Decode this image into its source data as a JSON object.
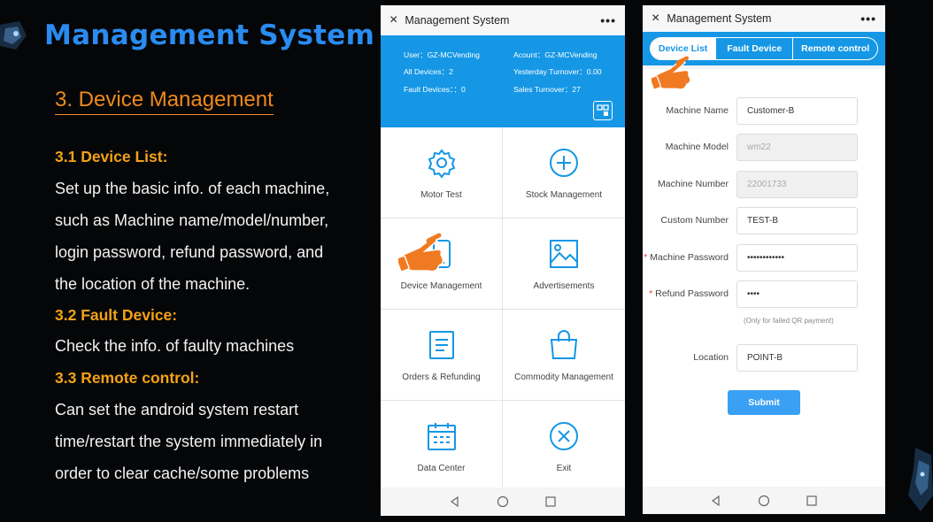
{
  "slide": {
    "title": "Management System",
    "section": "3. Device Management",
    "sub1": "3.1 Device List:",
    "p1": [
      "Set up the basic info. of each machine,",
      "such as Machine name/model/number,",
      "login password, refund password, and",
      "the location of the machine."
    ],
    "sub2": "3.2 Fault Device:",
    "p2": [
      "Check the info. of faulty machines"
    ],
    "sub3": "3.3 Remote control:",
    "p3": [
      "Can set the android system restart",
      "time/restart the system immediately in",
      "order to clear cache/some problems"
    ]
  },
  "phone1": {
    "topbar": {
      "title": "Management System",
      "close_icon": "×",
      "more_icon": "•••"
    },
    "info": {
      "user": "User：GZ-MCVending",
      "account": "Acount：GZ-MCVending",
      "all_devices": "All Devices：2",
      "yesterday_turnover": "Yesterday Turnover：0.00",
      "fault_devices": "Fault Devices：：0",
      "sales_turnover": "Sales Turnover：27"
    },
    "tiles": [
      {
        "label": "Motor Test",
        "icon": "gear-icon"
      },
      {
        "label": "Stock Management",
        "icon": "plus-circle-icon"
      },
      {
        "label": "Device Management",
        "icon": "phone-icon"
      },
      {
        "label": "Advertisements",
        "icon": "image-icon"
      },
      {
        "label": "Orders & Refunding",
        "icon": "document-icon"
      },
      {
        "label": "Commodity Management",
        "icon": "shopping-bag-icon"
      },
      {
        "label": "Data Center",
        "icon": "calendar-icon"
      },
      {
        "label": "Exit",
        "icon": "close-circle-icon"
      }
    ]
  },
  "phone2": {
    "topbar": {
      "title": "Management System",
      "close_icon": "×",
      "more_icon": "•••"
    },
    "tabs": [
      "Device List",
      "Fault Device",
      "Remote control"
    ],
    "fields": {
      "machine_name": {
        "label": "Machine Name",
        "value": "Customer-B"
      },
      "machine_model": {
        "label": "Machine Model",
        "value": "wm22"
      },
      "machine_number": {
        "label": "Machine Number",
        "value": "22001733"
      },
      "custom_number": {
        "label": "Custom Number",
        "value": "TEST-B"
      },
      "machine_password": {
        "label": "Machine Password",
        "value": "••••••••••••"
      },
      "refund_password": {
        "label": "Refund Password",
        "value": "••••"
      },
      "location": {
        "label": "Location",
        "value": "POINT-B"
      }
    },
    "required_mark": "*",
    "hint": "(Only for failed QR payment)",
    "submit": "Submit"
  },
  "colors": {
    "brand_blue": "#1597e5",
    "title_blue": "#2a8bf0",
    "accent_orange": "#f08a1c",
    "subtitle_gold": "#f5a214",
    "required_red": "#e33333"
  }
}
